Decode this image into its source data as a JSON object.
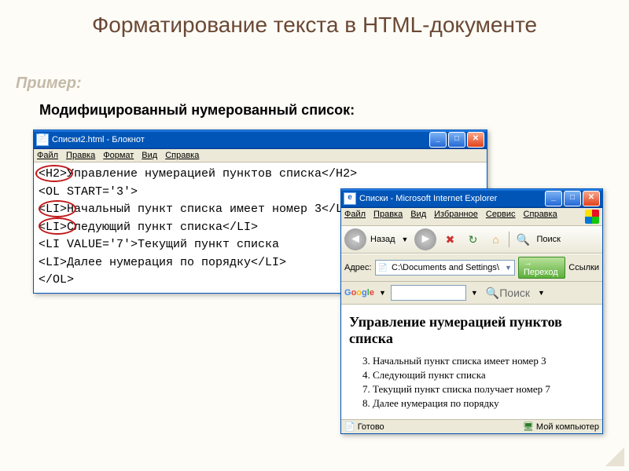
{
  "slide": {
    "title": "Форматирование текста в HTML-документе",
    "example_label": "Пример:",
    "subtitle": "Модифицированный нумерованный список:"
  },
  "notepad": {
    "title": "Списки2.html - Блокнот",
    "menu": {
      "file": "Файл",
      "edit": "Правка",
      "format": "Формат",
      "view": "Вид",
      "help": "Справка"
    },
    "lines": [
      "<H2>Управление нумерацией пунктов списка</H2>",
      "<OL START='3'>",
      "<LI>Начальный пункт списка имеет номер 3</LI>",
      "<LI>Следующий пункт списка</LI>",
      "<LI VALUE='7'>Текущий пункт списка",
      "<LI>Далее нумерация по порядку</LI>",
      "</OL>"
    ]
  },
  "ie": {
    "title": "Списки - Microsoft Internet Explorer",
    "menu": {
      "file": "Файл",
      "edit": "Правка",
      "view": "Вид",
      "fav": "Избранное",
      "tools": "Сервис",
      "help": "Справка"
    },
    "nav": {
      "back": "Назад"
    },
    "search": "Поиск",
    "addr_label": "Адрес:",
    "addr_value": "C:\\Documents and Settings\\",
    "go": "Переход",
    "links": "Ссылки",
    "google": {
      "label": "Google",
      "search_btn": "Поиск"
    },
    "page": {
      "heading": "Управление нумерацией пунктов списка",
      "items": [
        {
          "n": 3,
          "t": "Начальный пункт списка имеет номер 3"
        },
        {
          "n": 4,
          "t": "Следующий пункт списка"
        },
        {
          "n": 7,
          "t": "Текущий пункт списка получает номер 7"
        },
        {
          "n": 8,
          "t": "Далее нумерация по порядку"
        }
      ]
    },
    "status": {
      "ready": "Готово",
      "zone": "Мой компьютер"
    }
  }
}
